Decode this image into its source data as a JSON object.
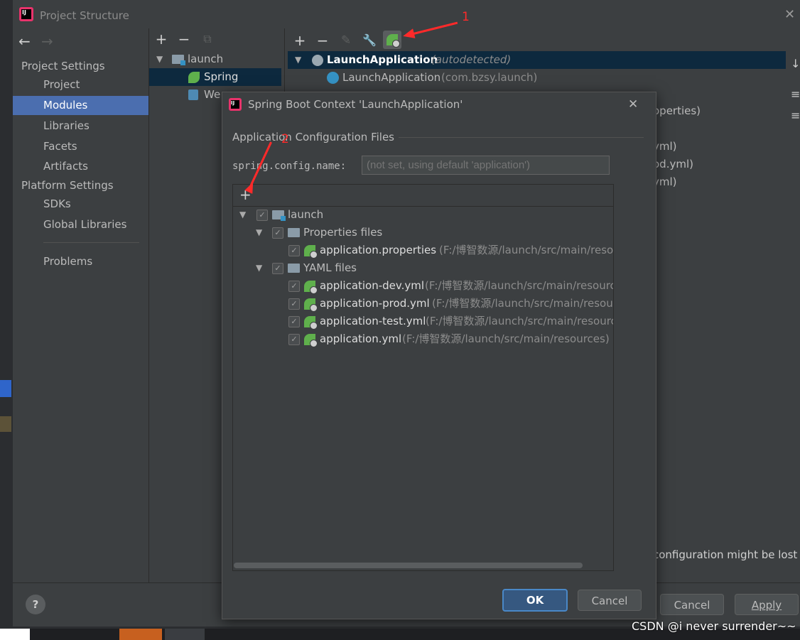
{
  "window": {
    "title": "Project Structure",
    "close_glyph": "✕"
  },
  "nav": {
    "back": "←",
    "forward": "→"
  },
  "sidebar": {
    "sections": [
      {
        "label": "Project Settings",
        "items": [
          "Project",
          "Modules",
          "Libraries",
          "Facets",
          "Artifacts"
        ]
      },
      {
        "label": "Platform Settings",
        "items": [
          "SDKs",
          "Global Libraries"
        ]
      }
    ],
    "problems": "Problems",
    "selected": "Modules"
  },
  "module_tree": {
    "toolbar": [
      "+",
      "−",
      "⧉"
    ],
    "root": "launch",
    "children": [
      "Spring",
      "Web"
    ],
    "selected": "Spring"
  },
  "facet_panel": {
    "toolbar": [
      "+",
      "−",
      "✎",
      "🔧"
    ],
    "row1_name": "LaunchApplication",
    "row1_note": "(autodetected)",
    "row2_name": "LaunchApplication",
    "row2_pkg": "(com.bzsy.launch)",
    "partial_lines": [
      "operties)",
      "yml)",
      "od.yml)",
      "yml)"
    ],
    "warning_tail": "configuration might be lost"
  },
  "dialog": {
    "title": "Spring Boot Context 'LaunchApplication'",
    "section": "Application Configuration Files",
    "config_label": "spring.config.name:",
    "config_placeholder": "(not set, using default 'application')",
    "add_btn": "+",
    "tree": {
      "root": "launch",
      "properties_group": "Properties files",
      "properties_files": [
        {
          "name": "application.properties",
          "path": "(F:/博智数源/launch/src/main/resou"
        }
      ],
      "yaml_group": "YAML files",
      "yaml_files": [
        {
          "name": "application-dev.yml",
          "path": "(F:/博智数源/launch/src/main/resourc"
        },
        {
          "name": "application-prod.yml",
          "path": "(F:/博智数源/launch/src/main/resour"
        },
        {
          "name": "application-test.yml",
          "path": "(F:/博智数源/launch/src/main/resourc"
        },
        {
          "name": "application.yml",
          "path": "(F:/博智数源/launch/src/main/resources)"
        }
      ]
    },
    "ok": "OK",
    "cancel": "Cancel"
  },
  "footer": {
    "help": "?",
    "cancel": "Cancel",
    "apply": "Apply"
  },
  "annotations": [
    "1",
    "2"
  ],
  "watermark": "CSDN @i never surrender~~",
  "colors": {
    "selection": "#4b6eaf",
    "tree_selection": "#0d293e",
    "annotation": "#ff2a2a",
    "spring": "#5fb04c"
  }
}
